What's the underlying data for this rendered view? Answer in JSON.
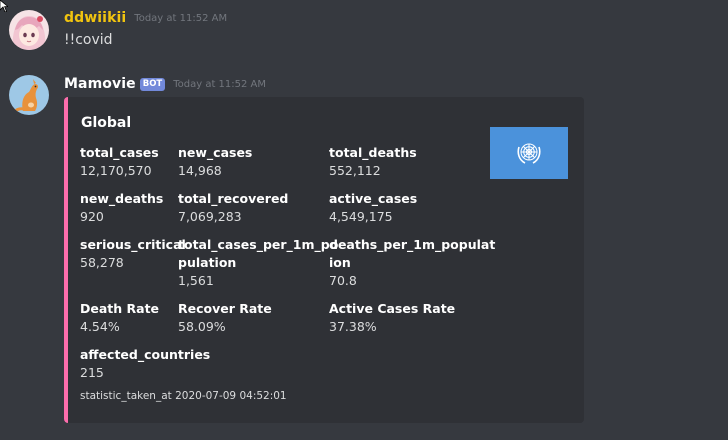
{
  "messages": [
    {
      "username": "ddwiikii",
      "timestamp": "Today at 11:52 AM",
      "text": "!!covid",
      "username_color": "#f1c40f"
    },
    {
      "username": "Mamovie",
      "badge": "BOT",
      "timestamp": "Today at 11:52 AM",
      "username_color": "#ffffff",
      "embed": {
        "accent_color": "#fc6dac",
        "title": "Global",
        "thumbnail_icon": "un-emblem-icon",
        "fields": [
          {
            "name": "total_cases",
            "value": "12,170,570"
          },
          {
            "name": "new_cases",
            "value": "14,968"
          },
          {
            "name": "total_deaths",
            "value": "552,112"
          },
          {
            "name": "new_deaths",
            "value": "920"
          },
          {
            "name": "total_recovered",
            "value": "7,069,283"
          },
          {
            "name": "active_cases",
            "value": "4,549,175"
          },
          {
            "name": "serious_critical",
            "value": "58,278"
          },
          {
            "name": "total_cases_per_1m_po",
            "name2": "pulation",
            "value": "1,561"
          },
          {
            "name": "deaths_per_1m_populat",
            "name2": "ion",
            "value": "70.8"
          },
          {
            "name": "Death Rate",
            "value": "4.54%"
          },
          {
            "name": "Recover Rate",
            "value": "58.09%"
          },
          {
            "name": "Active Cases Rate",
            "value": "37.38%"
          },
          {
            "name": "affected_countries",
            "value": "215"
          }
        ],
        "footer": "statistic_taken_at 2020-07-09 04:52:01"
      }
    }
  ]
}
